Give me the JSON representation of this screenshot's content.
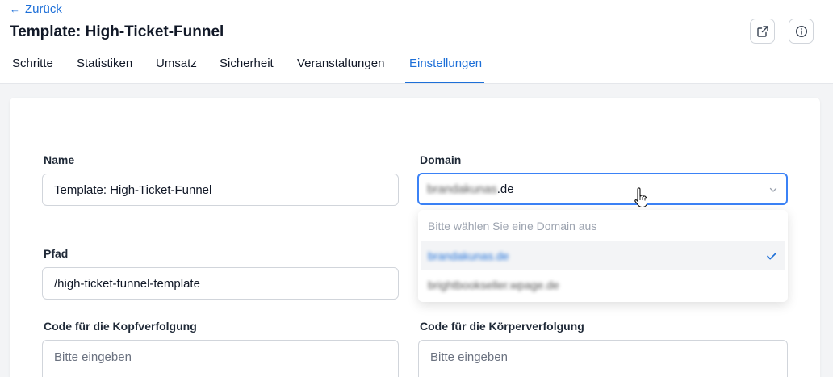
{
  "header": {
    "back_label": "Zurück",
    "title": "Template: High-Ticket-Funnel",
    "open_external_icon": "external-link-icon",
    "info_icon": "info-icon"
  },
  "tabs": [
    {
      "label": "Schritte",
      "active": false
    },
    {
      "label": "Statistiken",
      "active": false
    },
    {
      "label": "Umsatz",
      "active": false
    },
    {
      "label": "Sicherheit",
      "active": false
    },
    {
      "label": "Veranstaltungen",
      "active": false
    },
    {
      "label": "Einstellungen",
      "active": true
    }
  ],
  "form": {
    "name_label": "Name",
    "name_value": "Template: High-Ticket-Funnel",
    "domain_label": "Domain",
    "domain_value_blurred": "brandakunas",
    "domain_value_suffix": ".de",
    "path_label": "Pfad",
    "path_value": "/high-ticket-funnel-template",
    "head_code_label": "Code für die Kopfverfolgung",
    "head_code_placeholder": "Bitte eingeben",
    "body_code_label": "Code für die Körperverfolgung",
    "body_code_placeholder": "Bitte eingeben"
  },
  "domain_dropdown": {
    "placeholder": "Bitte wählen Sie eine Domain aus",
    "options": [
      {
        "label": "brandakunas.de",
        "selected": true,
        "blurred": true
      },
      {
        "label": "brightbookseller.wpage.de",
        "selected": false,
        "blurred": true
      }
    ]
  },
  "colors": {
    "accent": "#1d6fd8",
    "focus_border": "#3b82f6"
  }
}
